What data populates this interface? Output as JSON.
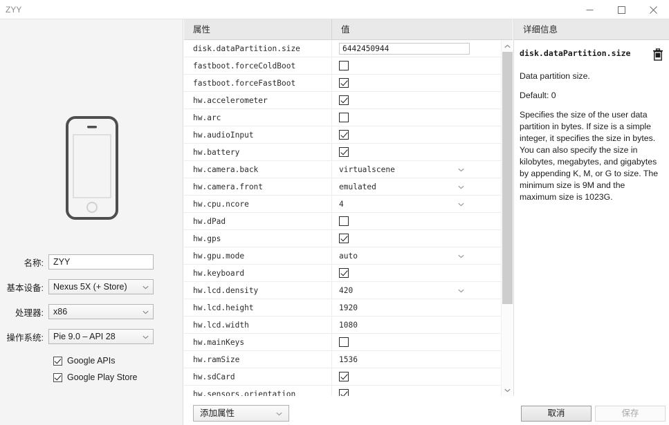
{
  "window": {
    "title": "ZYY",
    "minimize_label": "minimize",
    "maximize_label": "maximize",
    "close_label": "close"
  },
  "device_panel": {
    "fields": [
      {
        "label": "名称:",
        "value": "ZYY",
        "type": "text"
      },
      {
        "label": "基本设备:",
        "value": "Nexus 5X (+ Store)",
        "type": "select"
      },
      {
        "label": "处理器:",
        "value": "x86",
        "type": "select"
      },
      {
        "label": "操作系统:",
        "value": "Pie 9.0 – API 28",
        "type": "select"
      }
    ],
    "checkboxes": [
      {
        "label": "Google APIs",
        "checked": true
      },
      {
        "label": "Google Play Store",
        "checked": true
      }
    ]
  },
  "table": {
    "headers": {
      "property": "属性",
      "value": "值"
    },
    "rows": [
      {
        "property": "disk.dataPartition.size",
        "value": "6442450944",
        "type": "edit"
      },
      {
        "property": "fastboot.forceColdBoot",
        "value": "",
        "type": "checkbox",
        "checked": false
      },
      {
        "property": "fastboot.forceFastBoot",
        "value": "",
        "type": "checkbox",
        "checked": true
      },
      {
        "property": "hw.accelerometer",
        "value": "",
        "type": "checkbox",
        "checked": true
      },
      {
        "property": "hw.arc",
        "value": "",
        "type": "checkbox",
        "checked": false
      },
      {
        "property": "hw.audioInput",
        "value": "",
        "type": "checkbox",
        "checked": true
      },
      {
        "property": "hw.battery",
        "value": "",
        "type": "checkbox",
        "checked": true
      },
      {
        "property": "hw.camera.back",
        "value": "virtualscene",
        "type": "select"
      },
      {
        "property": "hw.camera.front",
        "value": "emulated",
        "type": "select"
      },
      {
        "property": "hw.cpu.ncore",
        "value": "4",
        "type": "select"
      },
      {
        "property": "hw.dPad",
        "value": "",
        "type": "checkbox",
        "checked": false
      },
      {
        "property": "hw.gps",
        "value": "",
        "type": "checkbox",
        "checked": true
      },
      {
        "property": "hw.gpu.mode",
        "value": "auto",
        "type": "select"
      },
      {
        "property": "hw.keyboard",
        "value": "",
        "type": "checkbox",
        "checked": true
      },
      {
        "property": "hw.lcd.density",
        "value": "420",
        "type": "select"
      },
      {
        "property": "hw.lcd.height",
        "value": "1920",
        "type": "text"
      },
      {
        "property": "hw.lcd.width",
        "value": "1080",
        "type": "text"
      },
      {
        "property": "hw.mainKeys",
        "value": "",
        "type": "checkbox",
        "checked": false
      },
      {
        "property": "hw.ramSize",
        "value": "1536",
        "type": "text"
      },
      {
        "property": "hw.sdCard",
        "value": "",
        "type": "checkbox",
        "checked": true
      },
      {
        "property": "hw.sensors.orientation",
        "value": "",
        "type": "checkbox",
        "checked": true
      }
    ]
  },
  "detail": {
    "header": "详细信息",
    "title": "disk.dataPartition.size",
    "summary": "Data partition size.",
    "default": "Default: 0",
    "description": "Specifies the size of the user data partition in bytes. If size is a simple integer, it specifies the size in bytes. You can also specify the size in kilobytes, megabytes, and gigabytes by appending K, M, or G to size. The minimum size is 9M and the maximum size is 1023G."
  },
  "bottom": {
    "add_property": "添加属性",
    "cancel": "取消",
    "save": "保存"
  }
}
